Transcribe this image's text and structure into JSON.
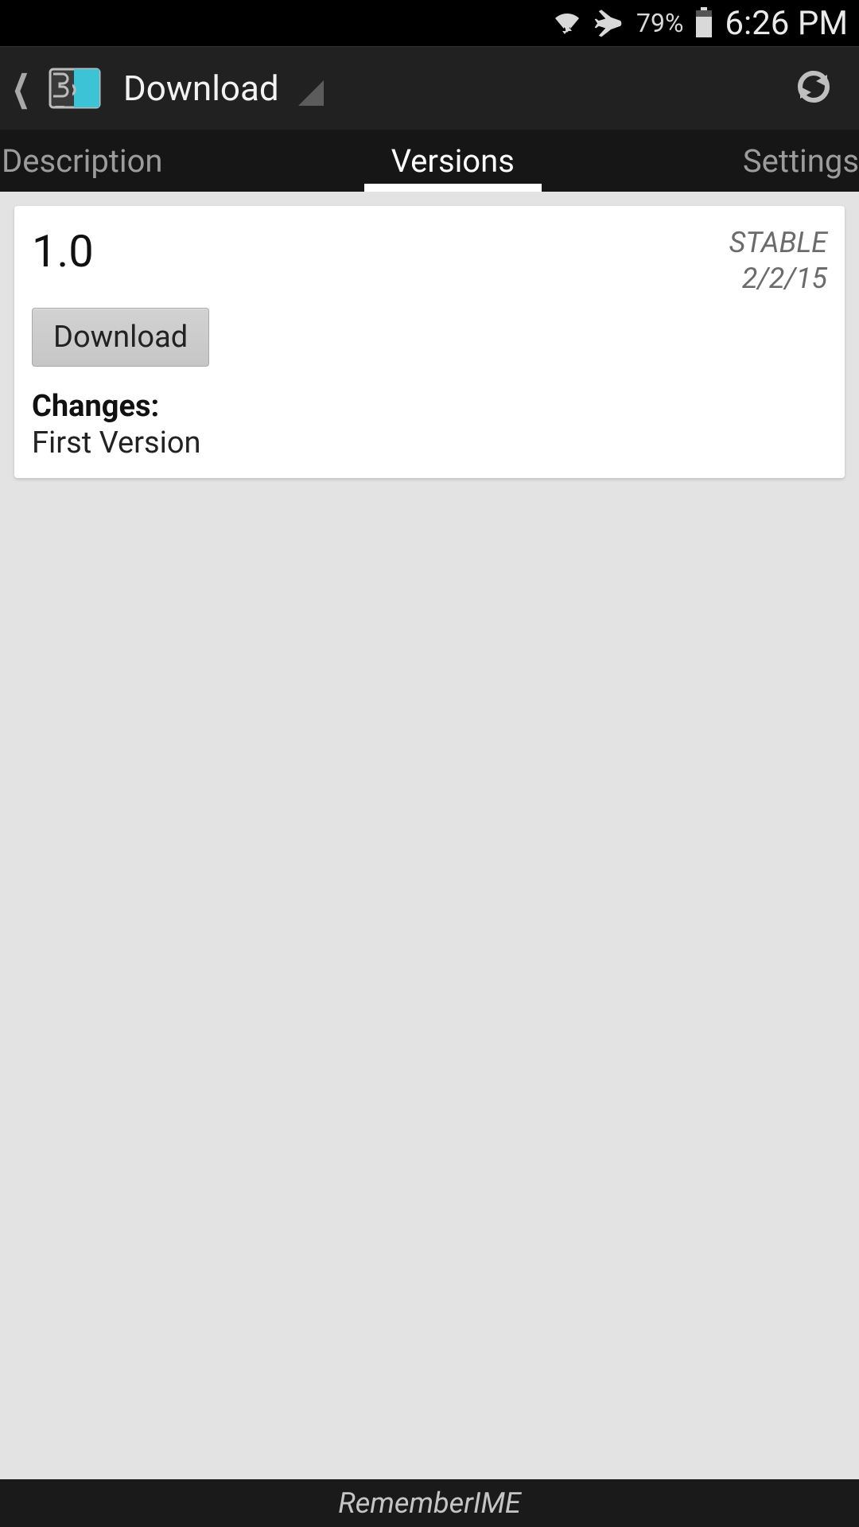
{
  "statusbar": {
    "battery_pct": "79%",
    "time": "6:26 PM"
  },
  "actionbar": {
    "title": "Download"
  },
  "tabs": {
    "description": "Description",
    "versions": "Versions",
    "settings": "Settings"
  },
  "card": {
    "version": "1.0",
    "stability": "STABLE",
    "date": "2/2/15",
    "download_btn": "Download",
    "changes_label": "Changes:",
    "changes_text": "First Version"
  },
  "footer": {
    "name": "RememberIME"
  }
}
